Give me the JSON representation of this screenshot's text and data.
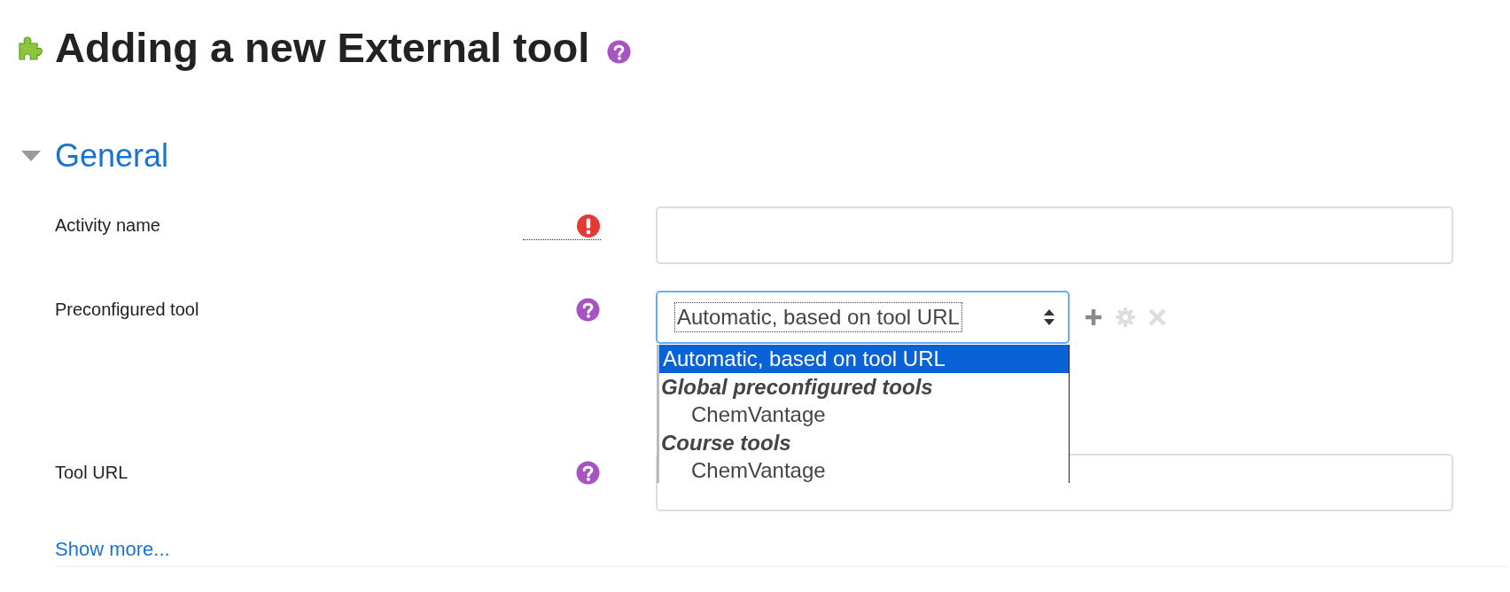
{
  "page": {
    "title": "Adding a new External tool",
    "help": true
  },
  "section": {
    "title": "General",
    "expanded": true
  },
  "fields": [
    {
      "kind": "text",
      "label": "Activity name",
      "required": true
    },
    {
      "kind": "select",
      "label": "Preconfigured tool",
      "help": true,
      "value": "Automatic, based on tool URL",
      "focused": true,
      "actions": [
        {
          "kind": "add",
          "disabled": false
        },
        {
          "kind": "settings",
          "disabled": true
        },
        {
          "kind": "delete",
          "disabled": true
        }
      ],
      "options": [
        {
          "kind": "option",
          "label": "Automatic, based on tool URL",
          "selected": true
        },
        {
          "kind": "group",
          "label": "Global preconfigured tools",
          "children": [
            {
              "label": "ChemVantage",
              "selected": false
            }
          ]
        },
        {
          "kind": "group",
          "label": "Course tools",
          "children": [
            {
              "label": "ChemVantage",
              "selected": false
            }
          ]
        }
      ]
    },
    {
      "kind": "text",
      "label": "Tool URL",
      "help": true
    }
  ],
  "show_more": "Show more..."
}
